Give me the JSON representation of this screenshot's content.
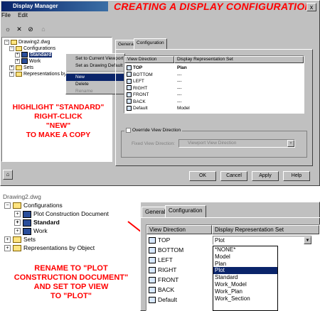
{
  "banner": "CREATING A DISPLAY CONFIGURATION",
  "window": {
    "title": "Display Manager",
    "close_glyph": "x"
  },
  "menu": [
    "File",
    "Edit"
  ],
  "toolbar_icons": [
    "new-config-icon",
    "delete-icon",
    "purge-icon",
    "properties-icon"
  ],
  "tree_top": {
    "root": "Drawing2.dwg",
    "configurations": "Configurations",
    "standard": "Standard",
    "work": "Work",
    "sets": "Sets",
    "representations": "Representations by Ob"
  },
  "context_menu": {
    "items": [
      "Set to Current Viewport",
      "Set as Drawing Default",
      "New",
      "Delete",
      "Rename"
    ],
    "selected": "New"
  },
  "tabs": [
    "General",
    "Configuration"
  ],
  "grid_top": {
    "headers": [
      "View Direction",
      "Display Representation Set"
    ],
    "rows": [
      {
        "view": "TOP",
        "set": "Plan"
      },
      {
        "view": "BOTTOM",
        "set": "---"
      },
      {
        "view": "LEFT",
        "set": "---"
      },
      {
        "view": "RIGHT",
        "set": "---"
      },
      {
        "view": "FRONT",
        "set": "---"
      },
      {
        "view": "BACK",
        "set": "---"
      },
      {
        "view": "Default",
        "set": "Model"
      }
    ]
  },
  "override": {
    "checkbox_label": "Override View Direction",
    "fixed_label": "Fixed View Direction:",
    "fixed_value": "Viewport View Direction"
  },
  "buttons": [
    "OK",
    "Cancel",
    "Apply",
    "Help"
  ],
  "annotation_top": [
    "HIGHLIGHT \"STANDARD\"",
    "RIGHT-CLICK",
    "\"NEW\"",
    "TO MAKE A COPY"
  ],
  "tree_bottom": {
    "root": "Drawing2.dwg",
    "configurations": "Configurations",
    "plot": "Plot Construction Document",
    "standard": "Standard",
    "work": "Work",
    "sets": "Sets",
    "representations": "Representations by Object"
  },
  "annotation_bottom": [
    "RENAME TO \"PLOT",
    "CONSTRUCTION DOCUMENT\"",
    "AND SET TOP VIEW",
    "TO \"PLOT\""
  ],
  "grid_bottom": {
    "headers": [
      "View Direction",
      "Display Representation Set"
    ],
    "views": [
      "TOP",
      "BOTTOM",
      "LEFT",
      "RIGHT",
      "FRONT",
      "BACK",
      "Default"
    ],
    "top_value": "Plot"
  },
  "dropdown": {
    "options": [
      "*NONE*",
      "Model",
      "Plan",
      "Plot",
      "Standard",
      "Work_Model",
      "Work_Plan",
      "Work_Section"
    ],
    "selected": "Plot"
  },
  "colors": {
    "annotation": "#ff0000",
    "selection": "#0a246a"
  }
}
